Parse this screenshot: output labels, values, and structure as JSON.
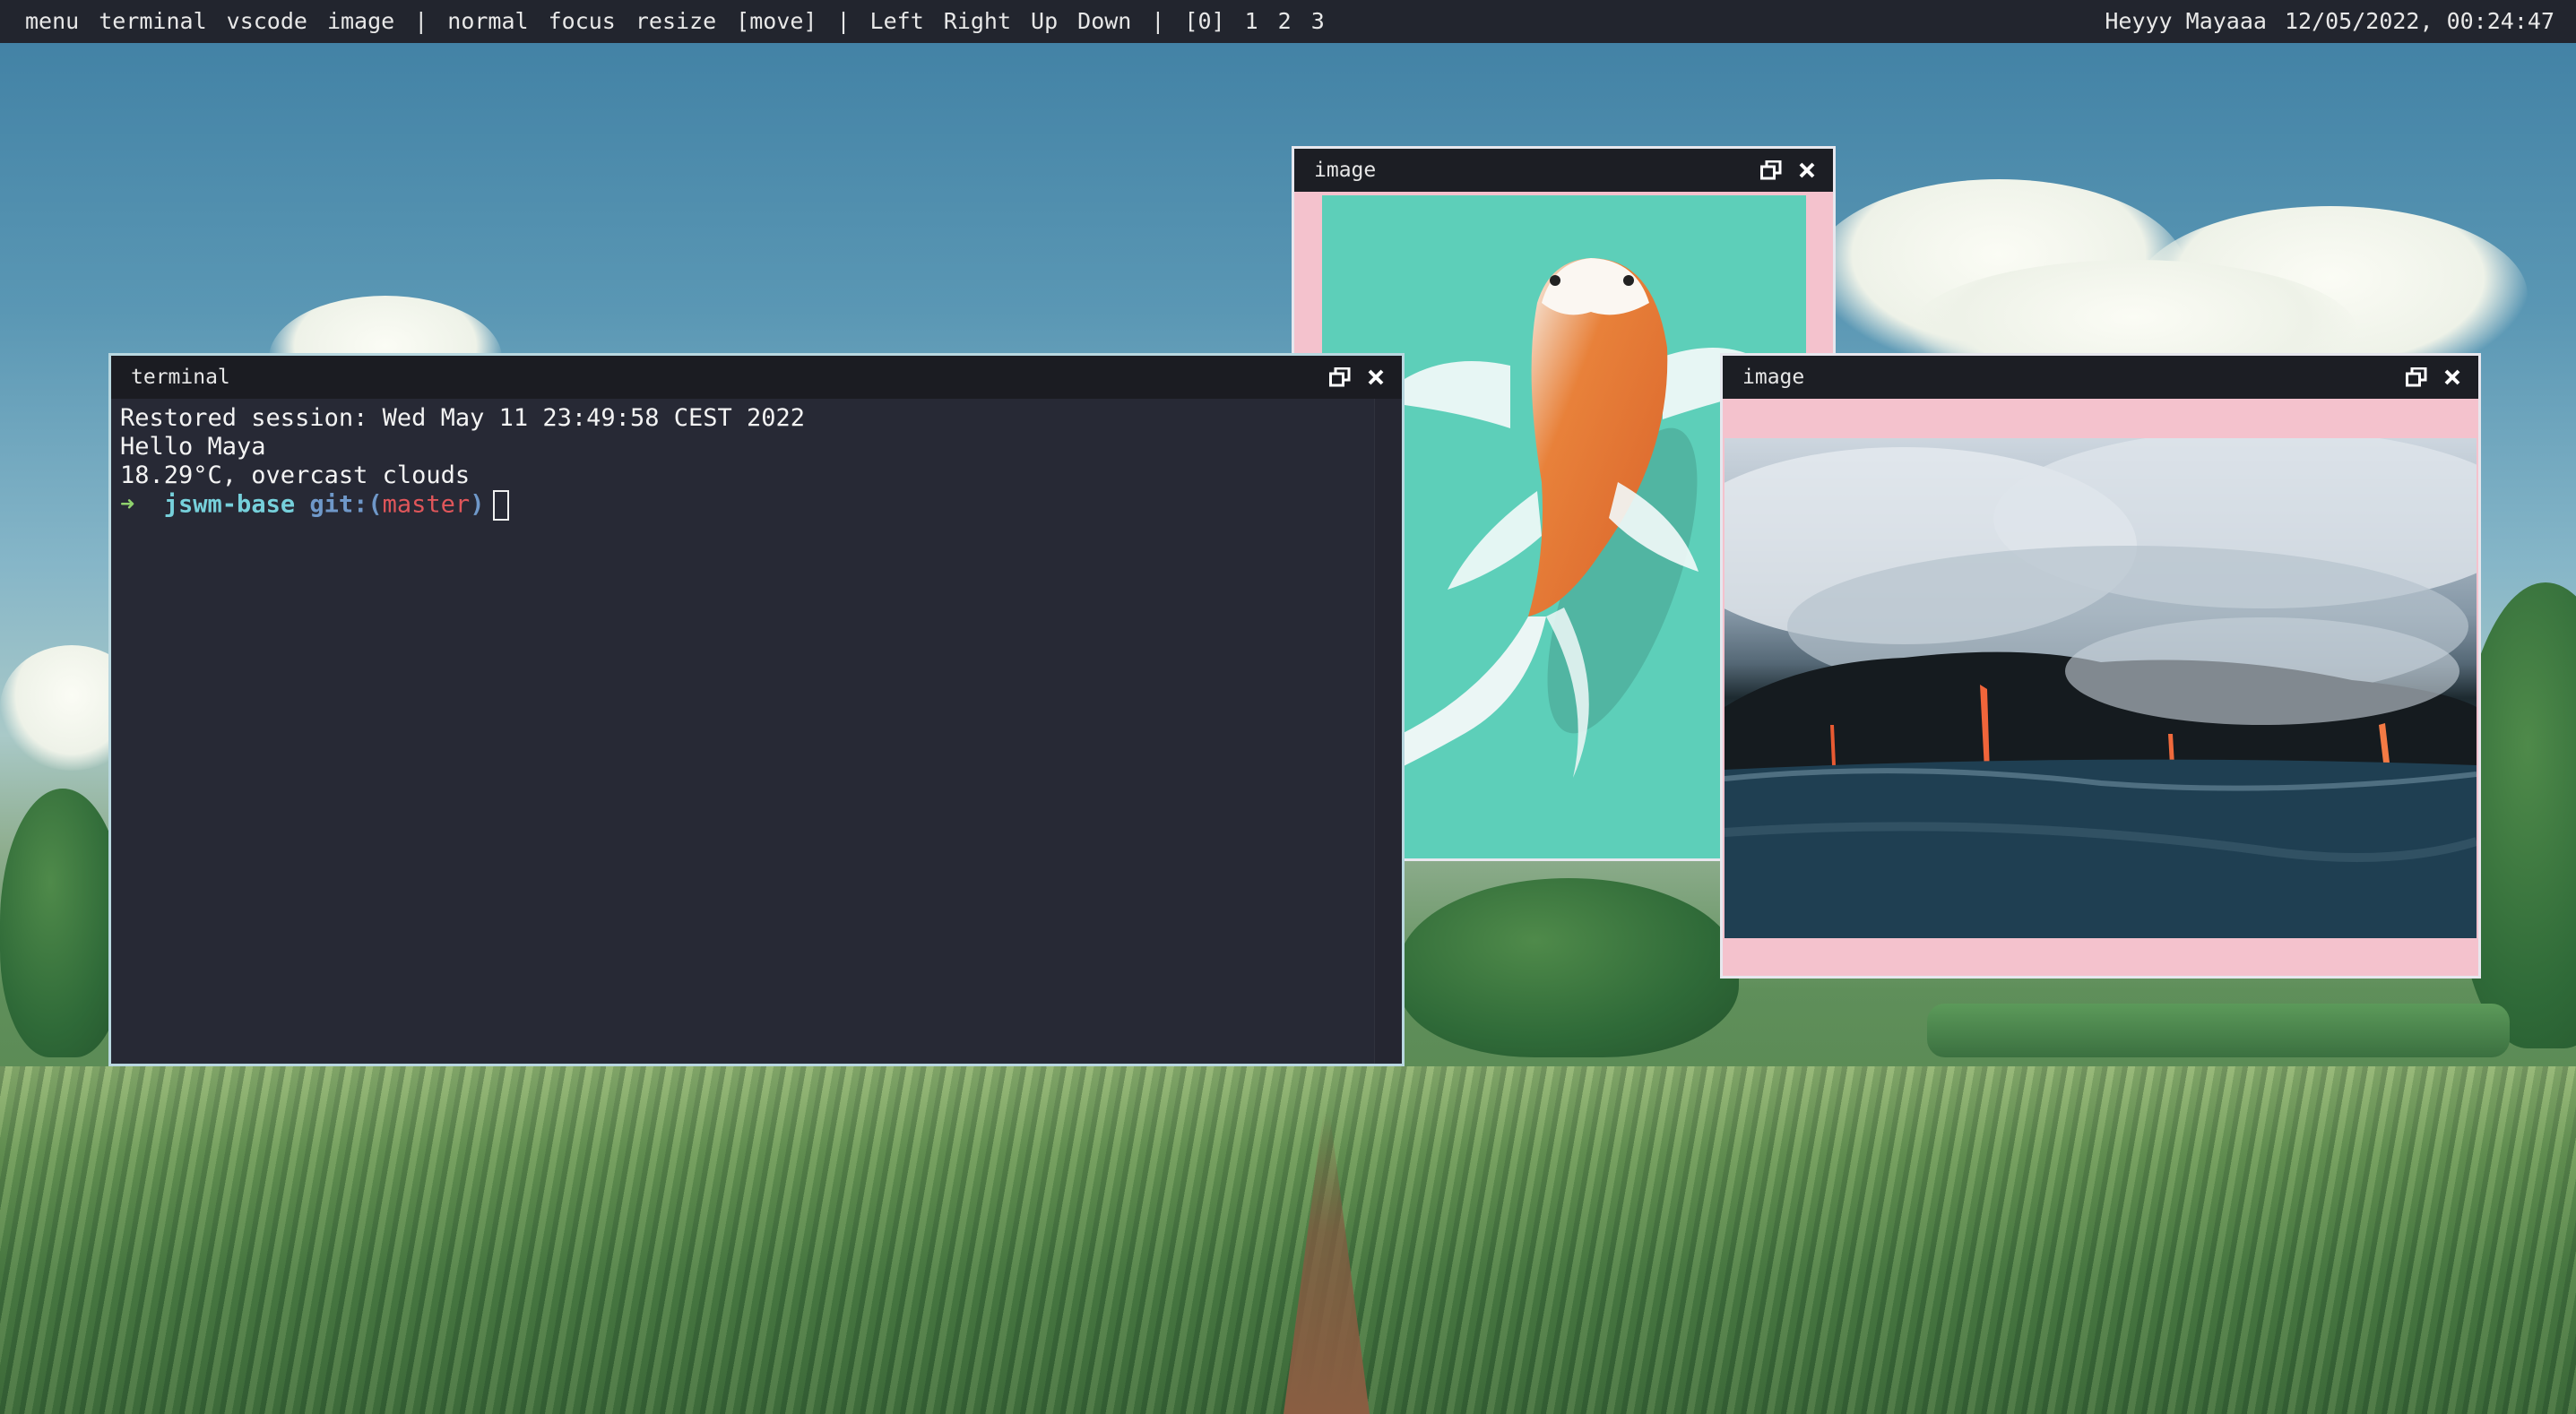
{
  "topbar": {
    "left_items": [
      "menu",
      "terminal",
      "vscode",
      "image",
      "|",
      "normal",
      "focus",
      "resize",
      "[move]",
      "|",
      "Left",
      "Right",
      "Up",
      "Down",
      "|",
      "[0]",
      "1",
      "2",
      "3"
    ],
    "greeting": "Heyyy Mayaaa",
    "datetime": "12/05/2022, 00:24:47"
  },
  "windows": {
    "terminal": {
      "title": "terminal",
      "lines": [
        "Restored session: Wed May 11 23:49:58 CEST 2022",
        "Hello Maya",
        "18.29°C, overcast clouds"
      ],
      "prompt": {
        "arrow": "➜",
        "dir": "jswm-base",
        "git_label": "git:",
        "branch_open": "(",
        "branch": "master",
        "branch_close": ")"
      }
    },
    "koi_image": {
      "title": "image",
      "content": "koi fish illustration"
    },
    "lava_image": {
      "title": "image",
      "content": "lava flowing into the ocean"
    }
  },
  "icons": {
    "restore": "restore-icon",
    "close": "close-icon"
  },
  "colors": {
    "topbar_bg": "#22252e",
    "terminal_bg": "#272935",
    "image_window_bg": "#f4c2cd",
    "koi_bg": "#5dcfb9"
  }
}
